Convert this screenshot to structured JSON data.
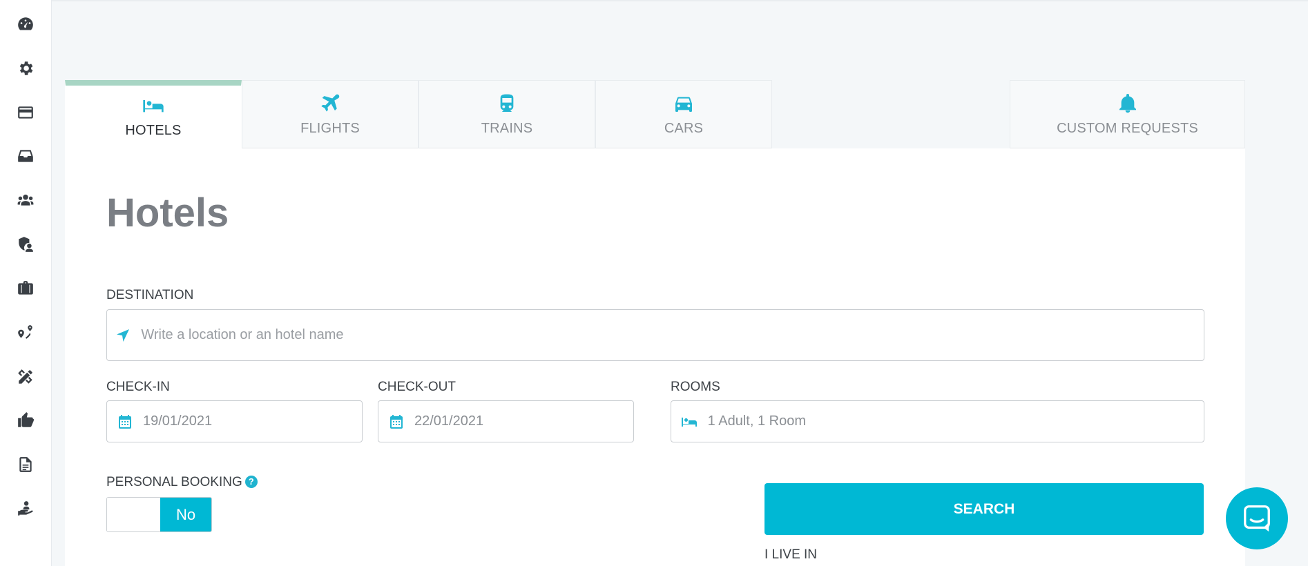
{
  "sidebar": {
    "items": [
      {
        "name": "dashboard-icon"
      },
      {
        "name": "settings-icon"
      },
      {
        "name": "credit-card-icon"
      },
      {
        "name": "inbox-icon"
      },
      {
        "name": "users-icon"
      },
      {
        "name": "security-user-icon"
      },
      {
        "name": "briefcase-icon"
      },
      {
        "name": "route-icon"
      },
      {
        "name": "tools-icon"
      },
      {
        "name": "thumbs-up-icon"
      },
      {
        "name": "document-icon"
      },
      {
        "name": "hand-user-icon"
      }
    ]
  },
  "tabs": [
    {
      "label": "HOTELS",
      "icon": "bed-icon",
      "active": true
    },
    {
      "label": "FLIGHTS",
      "icon": "plane-icon",
      "active": false
    },
    {
      "label": "TRAINS",
      "icon": "train-icon",
      "active": false
    },
    {
      "label": "CARS",
      "icon": "car-icon",
      "active": false
    },
    {
      "label": "CUSTOM REQUESTS",
      "icon": "bell-icon",
      "active": false
    }
  ],
  "form": {
    "title": "Hotels",
    "destination": {
      "label": "DESTINATION",
      "placeholder": "Write a location or an hotel name",
      "icon": "location-arrow-icon"
    },
    "checkin": {
      "label": "CHECK-IN",
      "value": "19/01/2021",
      "icon": "calendar-icon"
    },
    "checkout": {
      "label": "CHECK-OUT",
      "value": "22/01/2021",
      "icon": "calendar-icon"
    },
    "rooms": {
      "label": "ROOMS",
      "value": "1 Adult, 1 Room",
      "icon": "bed-icon"
    },
    "personal_booking": {
      "label": "PERSONAL BOOKING",
      "help": "?",
      "toggle_value": "No"
    },
    "search_label": "SEARCH",
    "i_live_in_label": "I LIVE IN"
  },
  "colors": {
    "accent": "#00b8d4",
    "icon_accent": "#23b6d3",
    "active_tab_bar": "#a8d5c4",
    "sidebar_icon": "#3a3f45"
  },
  "chat": {
    "icon": "chat-icon"
  }
}
